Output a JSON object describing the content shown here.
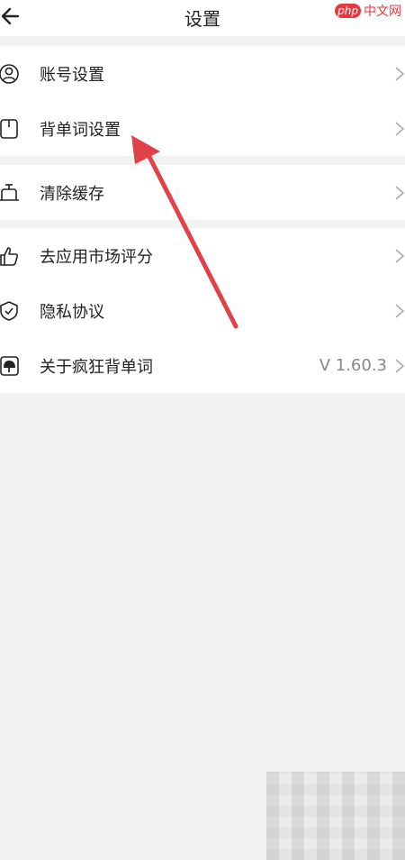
{
  "header": {
    "back_icon": "arrow-left-icon",
    "title": "设置"
  },
  "watermark": {
    "logo": "php",
    "text": "中文网"
  },
  "groups": [
    {
      "items": [
        {
          "label": "账号设置",
          "icon": "user-icon"
        },
        {
          "label": "背单词设置",
          "icon": "book-icon"
        }
      ]
    },
    {
      "items": [
        {
          "label": "清除缓存",
          "icon": "broom-icon"
        }
      ]
    },
    {
      "items": [
        {
          "label": "去应用市场评分",
          "icon": "thumbs-up-icon"
        },
        {
          "label": "隐私协议",
          "icon": "shield-check-icon"
        },
        {
          "label": "关于疯狂背单词",
          "icon": "app-logo-icon",
          "value": "V 1.60.3"
        }
      ]
    }
  ],
  "colors": {
    "annotation_arrow": "#e0424a",
    "background": "#f2f2f2",
    "row_background": "#ffffff"
  }
}
